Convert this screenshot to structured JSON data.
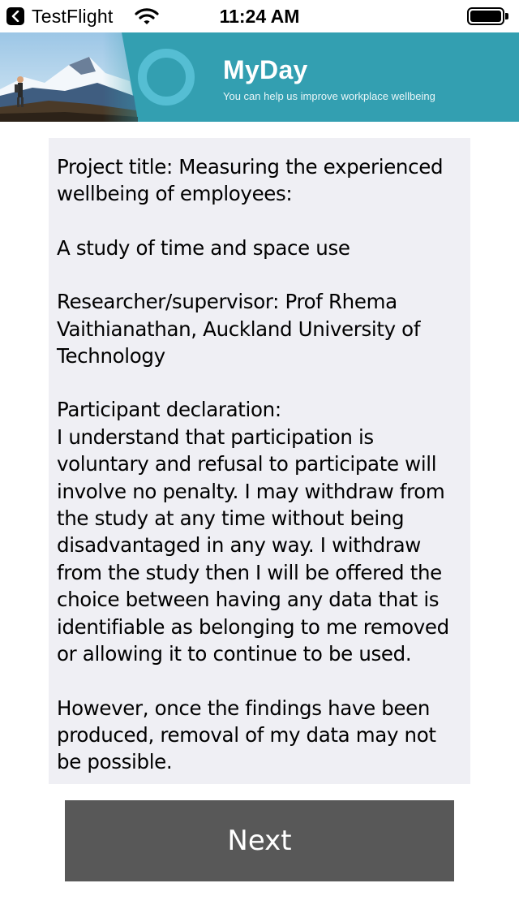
{
  "status_bar": {
    "back_app": "TestFlight",
    "time": "11:24 AM",
    "icons": [
      "back-chevron-icon",
      "wifi-icon",
      "battery-icon"
    ]
  },
  "banner": {
    "title": "MyDay",
    "tagline": "You can help us improve workplace wellbeing",
    "colors": {
      "background": "#339fb1",
      "ring": "#5cc3d9"
    }
  },
  "consent": {
    "project_title": "Project title: Measuring the experienced wellbeing of employees:",
    "subtitle": "A study of time and space use",
    "researcher": "Researcher/supervisor: Prof Rhema Vaithianathan, Auckland University of Technology",
    "declaration_heading": "Participant declaration:",
    "declaration_body": "I understand that participation is voluntary and refusal to participate will involve no penalty. I may withdraw from the study at any time without being disadvantaged in any way. I withdraw from the study then I will be offered the choice between having any data that is identifiable as belonging to me removed or allowing it to continue to be used.",
    "findings_note": "However, once the findings have been produced, removal of my data may not be possible."
  },
  "actions": {
    "next_label": "Next",
    "button_color": "#585858"
  }
}
